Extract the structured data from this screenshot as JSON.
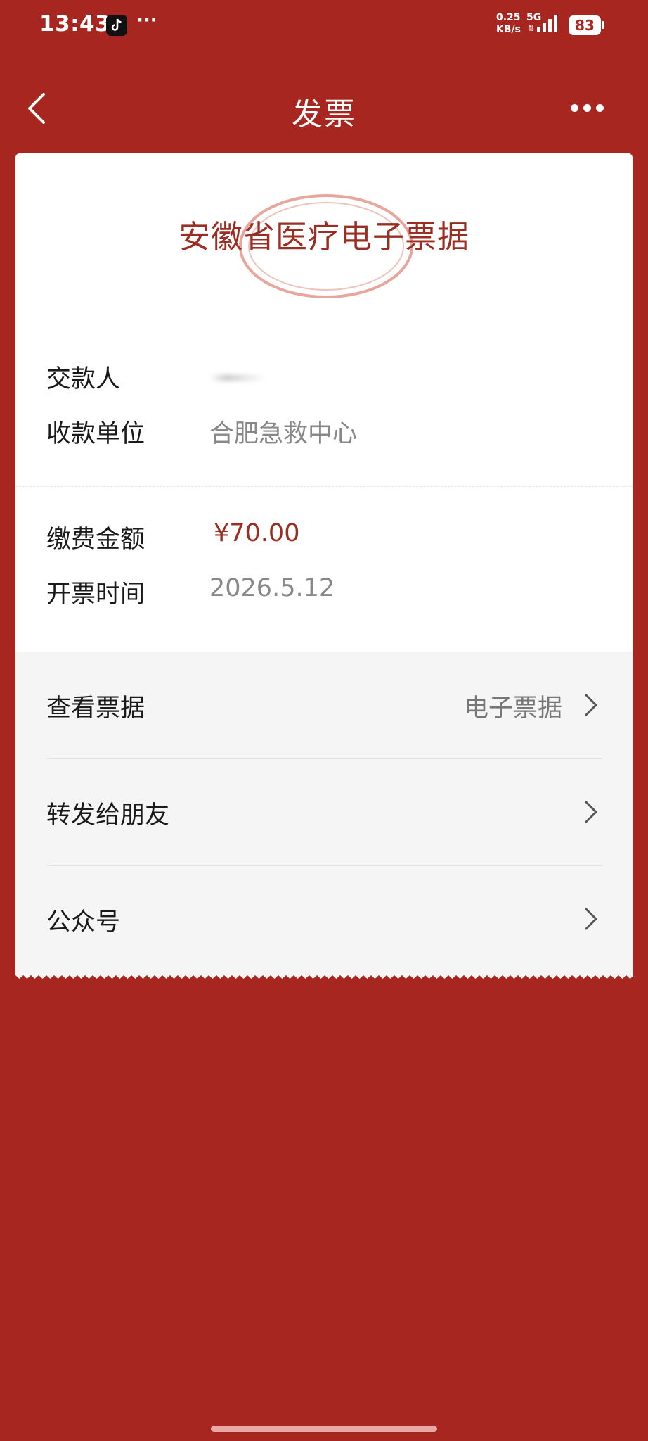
{
  "status_bar": {
    "time": "13:43",
    "dots": "···",
    "speed_value": "0.25",
    "speed_unit": "KB/s",
    "network": "5G",
    "battery": "83"
  },
  "nav": {
    "title": "发票"
  },
  "receipt": {
    "title": "安徽省医疗电子票据",
    "payer_label": "交款人",
    "payer_value": "",
    "payee_label": "收款单位",
    "payee_value": "合肥急救中心",
    "amount_label": "缴费金额",
    "amount_value": "¥70.00",
    "date_label": "开票时间",
    "date_value": "2026.5.12"
  },
  "actions": [
    {
      "label": "查看票据",
      "value": "电子票据"
    },
    {
      "label": "转发给朋友",
      "value": ""
    },
    {
      "label": "公众号",
      "value": ""
    }
  ],
  "colors": {
    "background": "#a82620",
    "title_red": "#9a2e23",
    "card": "#ffffff",
    "action_bg": "#f5f5f5"
  }
}
